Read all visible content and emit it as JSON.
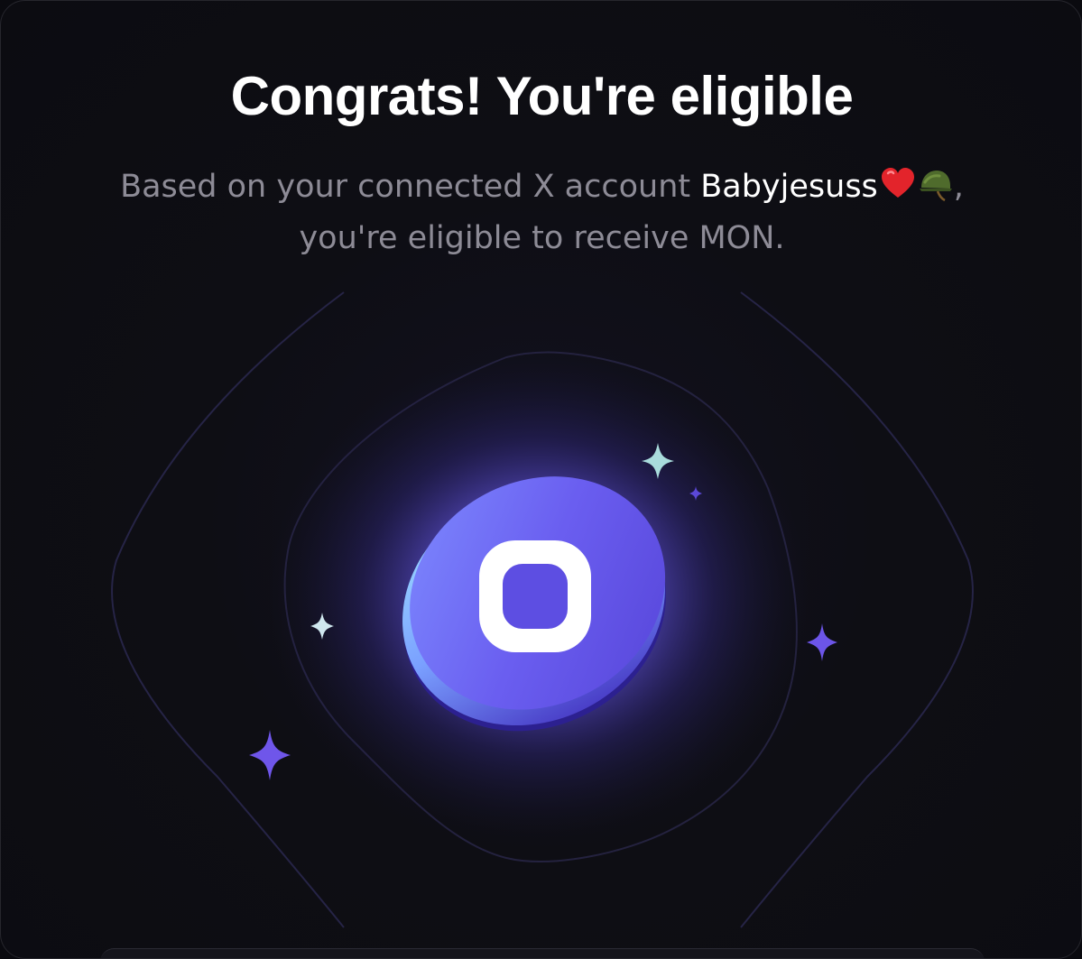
{
  "dialog": {
    "title": "Congrats! You're eligible",
    "subtitle_prefix": "Based on your connected X account ",
    "account_name": "Babyjesuss",
    "account_emojis": [
      "heart-emoji",
      "military-helmet-emoji"
    ],
    "subtitle_comma": ",",
    "subtitle_suffix": "you're eligible to receive MON."
  },
  "illustration": {
    "coin_icon": "mon-token-coin-icon",
    "sparkle_icons": [
      "sparkle-icon",
      "sparkle-icon",
      "sparkle-icon",
      "sparkle-icon",
      "sparkle-icon"
    ],
    "colors": {
      "accent": "#5b4fe0",
      "glow": "#7a6cff",
      "coin_light": "#8aa8ff",
      "sparkle_teal": "#a9dcdc",
      "sparkle_violet": "#7b5cf0"
    }
  }
}
